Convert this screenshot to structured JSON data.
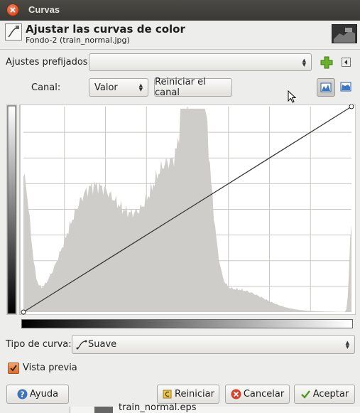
{
  "window": {
    "title": "Curvas"
  },
  "header": {
    "title": "Ajustar las curvas de color",
    "subtitle": "Fondo-2 (train_normal.jpg)"
  },
  "presets": {
    "label": "Ajustes prefijados:",
    "value": ""
  },
  "channel": {
    "label": "Canal:",
    "value": "Valor",
    "reset_label": "Reiniciar el canal"
  },
  "curve_type": {
    "label": "Tipo de curva:",
    "value": "Suave"
  },
  "preview": {
    "label": "Vista previa",
    "checked": true
  },
  "buttons": {
    "help": "Ayuda",
    "reset": "Reiniciar",
    "cancel": "Cancelar",
    "ok": "Aceptar"
  },
  "background_window": {
    "text": "train_normal.eps"
  },
  "colors": {
    "accent": "#e06d2c",
    "histogram": "#cfcdc9",
    "titlebar": "#3c3b37"
  }
}
